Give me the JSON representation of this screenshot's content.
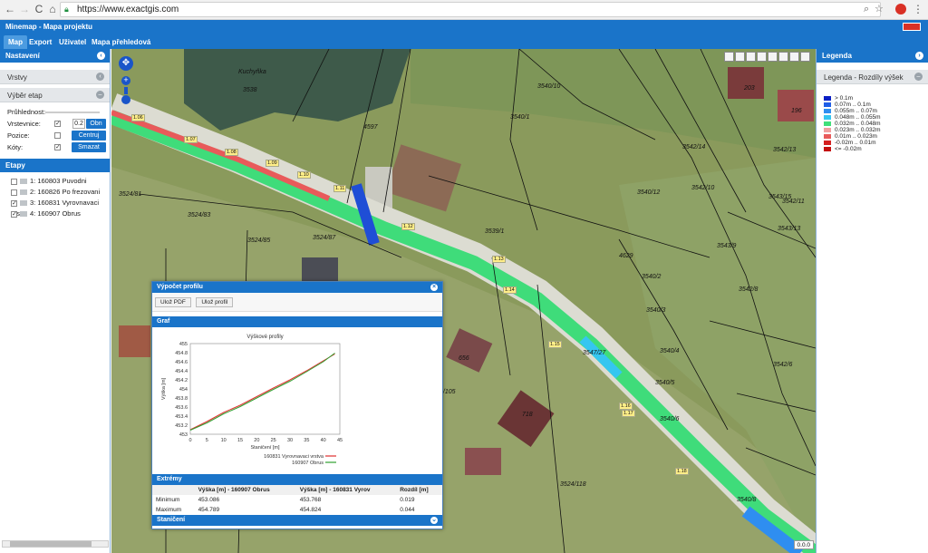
{
  "browser": {
    "url": "https://www.exactgis.com",
    "nav_back": "←",
    "nav_fwd": "→",
    "nav_reload": "C",
    "nav_home": "⌂",
    "menu_icon": "⋮",
    "zoom_icon": "⌕",
    "star_icon": "☆"
  },
  "app": {
    "title": "Minemap - Mapa projektu"
  },
  "tabs": [
    {
      "label": "Map",
      "active": true
    },
    {
      "label": "Export",
      "active": false
    },
    {
      "label": "Uživatel",
      "active": false
    },
    {
      "label": "Mapa přehledová",
      "active": false
    }
  ],
  "left_panel": {
    "title": "Nastavení",
    "sections": [
      "Vrstvy",
      "Výběr etap"
    ],
    "form": {
      "transparency_label": "Průhlednost:",
      "contours_label": "Vrstevnice:",
      "contours_value": "0.2",
      "contours_button": "Obn",
      "position_label": "Pozice:",
      "position_button": "Centruj",
      "heights_label": "Kóty:",
      "heights_button": "Smazat"
    },
    "etapy_title": "Etapy",
    "etapy": [
      {
        "label": "1: 160803 Puvodni",
        "checked": false
      },
      {
        "label": "2: 160826 Po frezovani",
        "checked": false
      },
      {
        "label": "3: 160831 Vyrovnavaci vrs",
        "checked": true
      },
      {
        "label": "4: 160907 Obrus",
        "checked": true
      }
    ]
  },
  "right_panel": {
    "title": "Legenda",
    "subtitle": "Legenda - Rozdíly výšek",
    "legend": [
      {
        "label": "> 0.1m",
        "color": "#0b1fc4"
      },
      {
        "label": "0.07m .. 0.1m",
        "color": "#1f5ee6"
      },
      {
        "label": "0.055m .. 0.07m",
        "color": "#2f8ef0"
      },
      {
        "label": "0.048m .. 0.055m",
        "color": "#35c6f0"
      },
      {
        "label": "0.032m .. 0.048m",
        "color": "#3fe07a"
      },
      {
        "label": "0.023m .. 0.032m",
        "color": "#f0a0a0"
      },
      {
        "label": "0.01m .. 0.023m",
        "color": "#e85a5a"
      },
      {
        "label": "-0.02m .. 0.01m",
        "color": "#d52020"
      },
      {
        "label": "<= -0.02m",
        "color": "#c41010"
      }
    ]
  },
  "map": {
    "labels": [
      {
        "t": "Kuchyňka"
      },
      {
        "t": "3538"
      },
      {
        "t": "3540/10"
      },
      {
        "t": "3540/1"
      },
      {
        "t": "3542/14"
      },
      {
        "t": "3542/13"
      },
      {
        "t": "3542/10"
      },
      {
        "t": "3542/11"
      },
      {
        "t": "3543/15"
      },
      {
        "t": "3543/13"
      },
      {
        "t": "3540/12"
      },
      {
        "t": "3524/81"
      },
      {
        "t": "3524/83"
      },
      {
        "t": "3524/85"
      },
      {
        "t": "3524/87"
      },
      {
        "t": "3539/1"
      },
      {
        "t": "4629"
      },
      {
        "t": "3540/2"
      },
      {
        "t": "3543/9"
      },
      {
        "t": "3542/8"
      },
      {
        "t": "3540/3"
      },
      {
        "t": "3547/27"
      },
      {
        "t": "3540/4"
      },
      {
        "t": "3542/6"
      },
      {
        "t": "3540/5"
      },
      {
        "t": "3540/6"
      },
      {
        "t": "3524/118"
      },
      {
        "t": "3540/8"
      },
      {
        "t": "203"
      },
      {
        "t": "196"
      },
      {
        "t": "656"
      },
      {
        "t": "718"
      },
      {
        "t": "4597"
      },
      {
        "t": "4/105"
      }
    ],
    "points": [
      "1.06",
      "1.07",
      "1.08",
      "1.09",
      "1.10",
      "1.11",
      "1.12",
      "1.13",
      "1.14",
      "1.15",
      "1.16",
      "1.17",
      "1.18"
    ],
    "scale": "0.0.0",
    "tools_count": 8
  },
  "profile_dialog": {
    "title": "Výpočet profilu",
    "btn_pdf": "Ulož PDF",
    "btn_profile": "Ulož profil",
    "graph_title": "Graf",
    "chart_data": {
      "type": "line",
      "title": "Výškové profily",
      "xlabel": "Staničení [m]",
      "ylabel": "Výška [m]",
      "xlim": [
        0,
        45
      ],
      "ylim": [
        453,
        455
      ],
      "xticks": [
        0,
        5,
        10,
        15,
        20,
        25,
        30,
        35,
        40,
        45
      ],
      "yticks": [
        453,
        453.2,
        453.4,
        453.6,
        453.8,
        454,
        454.2,
        454.4,
        454.6,
        454.8,
        455
      ],
      "series": [
        {
          "name": "160831 Vyrovnavaci vrstva",
          "color": "#e03030",
          "x": [
            0,
            5,
            10,
            15,
            20,
            25,
            30,
            35,
            40,
            43.5
          ],
          "y": [
            453.1,
            453.28,
            453.48,
            453.64,
            453.83,
            454.02,
            454.2,
            454.4,
            454.62,
            454.77
          ]
        },
        {
          "name": "160907 Obrus",
          "color": "#30a030",
          "x": [
            0,
            5,
            10,
            15,
            20,
            25,
            30,
            35,
            40,
            43.5
          ],
          "y": [
            453.09,
            453.25,
            453.45,
            453.61,
            453.8,
            453.99,
            454.17,
            454.38,
            454.6,
            454.79
          ]
        }
      ]
    },
    "extremes_title": "Extrémy",
    "extremes": {
      "headers": [
        "",
        "Výška [m] - 160907 Obrus",
        "Výška [m] - 160831 Vyrov",
        "Rozdíl [m]"
      ],
      "rows": [
        [
          "Minimum",
          "453.086",
          "453.768",
          "0.019"
        ],
        [
          "Maximum",
          "454.789",
          "454.824",
          "0.044"
        ]
      ]
    },
    "stationing_title": "Staničení"
  }
}
